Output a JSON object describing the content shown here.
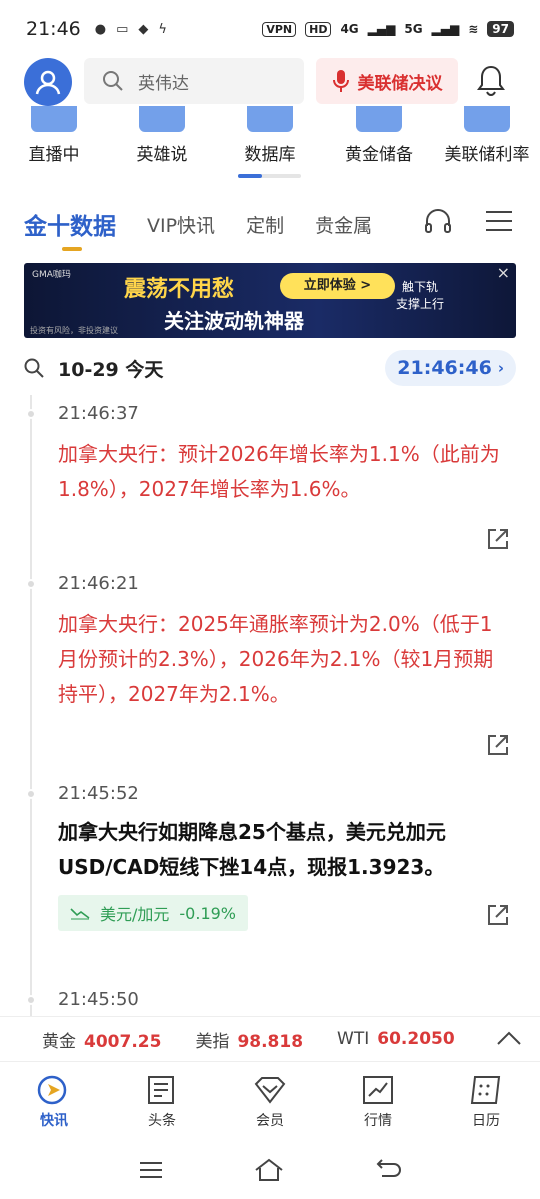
{
  "status_bar": {
    "time": "21:46",
    "vpn": "VPN",
    "hd": "HD",
    "net1": "4G",
    "net2": "5G",
    "battery": "97"
  },
  "header": {
    "search_placeholder": "英伟达",
    "fed_button": "美联储决议"
  },
  "shortcuts": [
    {
      "label": "直播中"
    },
    {
      "label": "英雄说"
    },
    {
      "label": "数据库"
    },
    {
      "label": "黄金储备"
    },
    {
      "label": "美联储利率"
    }
  ],
  "tabs": [
    {
      "label": "金十数据",
      "active": true
    },
    {
      "label": "VIP快讯"
    },
    {
      "label": "定制"
    },
    {
      "label": "贵金属"
    }
  ],
  "banner": {
    "brand": "GMA咖玛",
    "title1": "震荡不用愁",
    "button": "立即体验 >",
    "title2": "关注波动轨神器",
    "side_line1": "触下轨",
    "side_line2": "支撑上行",
    "disclaimer": "投资有风险，非投资建议",
    "close": "×"
  },
  "date_row": {
    "date": "10-29 今天",
    "clock": "21:46:46"
  },
  "feed": [
    {
      "time": "21:46:37",
      "text": "加拿大央行：预计2026年增长率为1.1%（此前为1.8%），2027年增长率为1.6%。",
      "style": "red"
    },
    {
      "time": "21:46:21",
      "text": "加拿大央行：2025年通胀率预计为2.0%（低于1月份预计的2.3%），2026年为2.1%（较1月预期持平），2027年为2.1%。",
      "style": "red"
    },
    {
      "time": "21:45:52",
      "text": "加拿大央行如期降息25个基点，美元兑加元USD/CAD短线下挫14点，现报1.3923。",
      "style": "bold",
      "tag": {
        "name": "美元/加元",
        "change": "-0.19%"
      }
    },
    {
      "time": "21:45:50",
      "text": "",
      "style": "normal"
    }
  ],
  "ticker": [
    {
      "name": "黄金",
      "value": "4007.25"
    },
    {
      "name": "美指",
      "value": "98.818"
    },
    {
      "name": "WTI",
      "value": "60.2050"
    }
  ],
  "bottom_nav": [
    {
      "label": "快讯",
      "active": true
    },
    {
      "label": "头条"
    },
    {
      "label": "会员"
    },
    {
      "label": "行情"
    },
    {
      "label": "日历"
    }
  ],
  "colors": {
    "accent": "#2e61c9",
    "red": "#d93a3a",
    "green": "#2f9d55",
    "tab_underline": "#e5a522"
  }
}
